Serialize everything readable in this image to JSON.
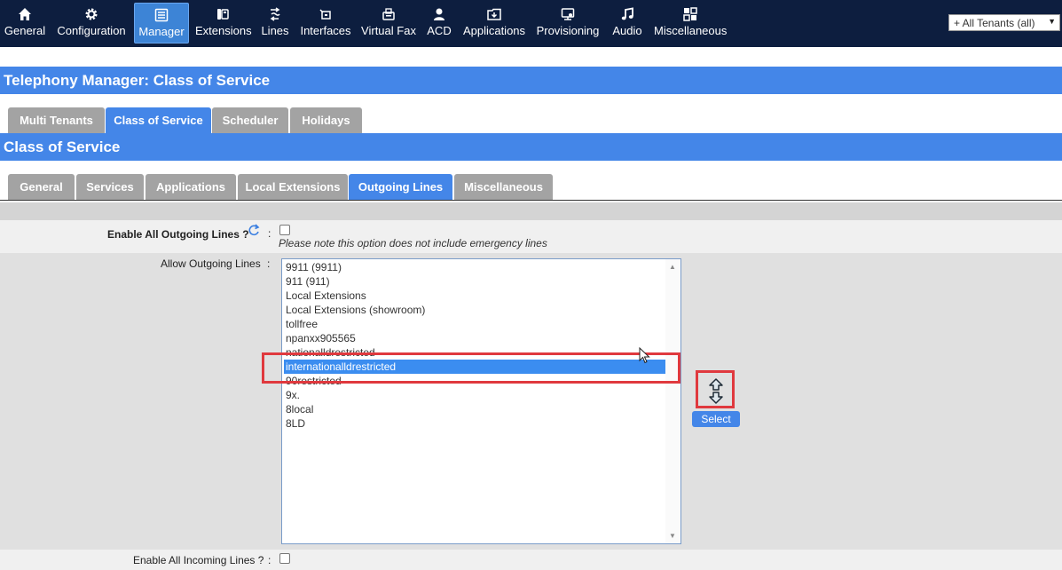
{
  "nav": {
    "items": [
      {
        "label": "General",
        "icon": "home-icon"
      },
      {
        "label": "Configuration",
        "icon": "gear-icon"
      },
      {
        "label": "Manager",
        "icon": "manager-icon"
      },
      {
        "label": "Extensions",
        "icon": "extensions-icon"
      },
      {
        "label": "Lines",
        "icon": "lines-icon"
      },
      {
        "label": "Interfaces",
        "icon": "interfaces-icon"
      },
      {
        "label": "Virtual Fax",
        "icon": "fax-icon"
      },
      {
        "label": "ACD",
        "icon": "agent-icon"
      },
      {
        "label": "Applications",
        "icon": "applications-icon"
      },
      {
        "label": "Provisioning",
        "icon": "provisioning-icon"
      },
      {
        "label": "Audio",
        "icon": "music-note-icon"
      },
      {
        "label": "Miscellaneous",
        "icon": "grid-icon"
      }
    ],
    "active": "Manager",
    "tenant_select": "+ All Tenants (all)"
  },
  "page_title": "Telephony Manager:  Class of Service",
  "tabs_top": [
    "Multi Tenants",
    "Class of Service",
    "Scheduler",
    "Holidays"
  ],
  "tabs_top_active": "Class of Service",
  "section_title": "Class of Service",
  "tabs_sub": [
    "General",
    "Services",
    "Applications",
    "Local Extensions",
    "Outgoing Lines",
    "Miscellaneous"
  ],
  "tabs_sub_active": "Outgoing Lines",
  "form": {
    "enable_all_outgoing_label": "Enable All Outgoing Lines ?",
    "enable_all_outgoing_checked": false,
    "note": "Please note this option does not include emergency lines",
    "allow_outgoing_label": "Allow Outgoing Lines",
    "colon": ":",
    "lines": [
      "9911 (9911)",
      "911 (911)",
      "Local Extensions",
      "Local Extensions (showroom)",
      "tollfree",
      "npanxx905565",
      "nationalldrestricted",
      "internationalldrestricted",
      "90restricted",
      "9x.",
      "8local",
      "8LD"
    ],
    "selected_line": "internationalldrestricted",
    "select_button": "Select",
    "enable_all_incoming_label": "Enable All Incoming Lines ?",
    "enable_all_incoming_checked": false
  },
  "colors": {
    "nav_bg": "#0d1e3f",
    "accent": "#4486e8",
    "tab_inactive": "#a3a3a3",
    "highlight_box": "#e0393e"
  }
}
